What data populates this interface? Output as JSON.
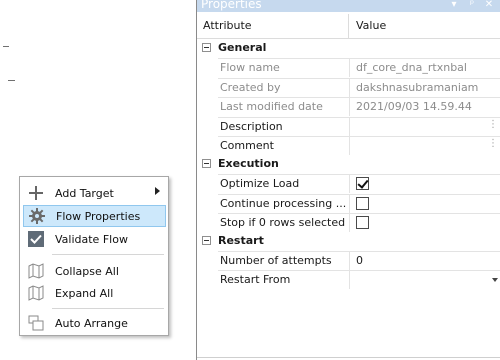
{
  "context_menu": {
    "items": [
      {
        "label": "Add Target",
        "icon": "plus-icon",
        "has_submenu": true
      },
      {
        "label": "Flow Properties",
        "icon": "gear-icon",
        "selected": true
      },
      {
        "label": "Validate Flow",
        "icon": "checkmark-icon"
      },
      {
        "label": "Collapse All",
        "icon": "map-icon"
      },
      {
        "label": "Expand All",
        "icon": "map-icon"
      },
      {
        "label": "Auto Arrange",
        "icon": "arrange-icon"
      }
    ]
  },
  "properties": {
    "title": "Properties",
    "title_buttons": [
      "▾",
      "ᵖ",
      "✕"
    ],
    "header": {
      "attribute": "Attribute",
      "value": "Value"
    },
    "categories": [
      {
        "name": "General",
        "rows": [
          {
            "name": "Flow name",
            "value": "df_core_dna_rtxnbal",
            "readonly": true
          },
          {
            "name": "Created by",
            "value": "dakshnasubramaniam",
            "readonly": true
          },
          {
            "name": "Last modified date",
            "value": "2021/09/03 14.59.44",
            "readonly": true
          },
          {
            "name": "Description",
            "value": "",
            "editor": "ellipsis"
          },
          {
            "name": "Comment",
            "value": "",
            "editor": "ellipsis"
          }
        ]
      },
      {
        "name": "Execution",
        "rows": [
          {
            "name": "Optimize Load",
            "checked": true,
            "editor": "checkbox"
          },
          {
            "name": "Continue processing ...",
            "checked": false,
            "editor": "checkbox"
          },
          {
            "name": "Stop if 0 rows selected",
            "checked": false,
            "editor": "checkbox"
          }
        ]
      },
      {
        "name": "Restart",
        "rows": [
          {
            "name": "Number of attempts",
            "value": "0"
          },
          {
            "name": "Restart From",
            "value": "",
            "editor": "dropdown"
          }
        ]
      }
    ],
    "ellipsis_glyph": "⋮"
  }
}
